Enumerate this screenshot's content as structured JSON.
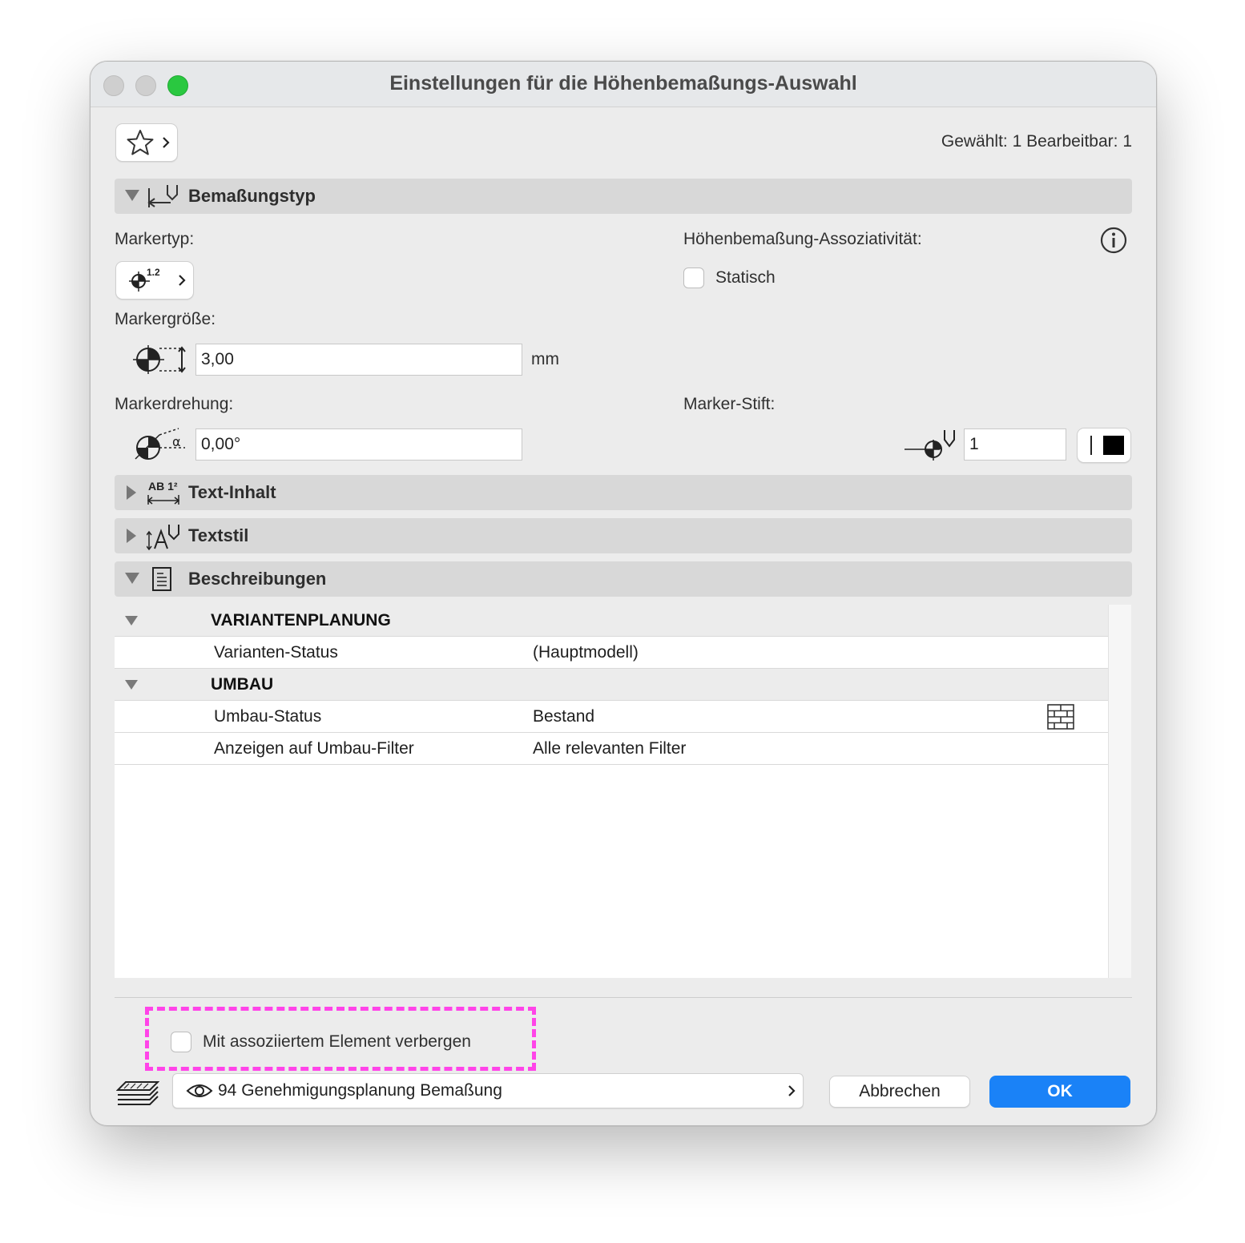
{
  "window": {
    "title": "Einstellungen für die Höhenbemaßungs-Auswahl"
  },
  "header": {
    "selection_info": "Gewählt: 1 Bearbeitbar: 1"
  },
  "sections": {
    "dimension_type": "Bemaßungstyp",
    "text_content": "Text-Inhalt",
    "text_style": "Textstil",
    "descriptions": "Beschreibungen"
  },
  "dimension_type": {
    "marker_type_label": "Markertyp:",
    "marker_icon_label": "1.2",
    "associativity_label": "Höhenbemaßung-Assoziativität:",
    "static_label": "Statisch",
    "marker_size_label": "Markergröße:",
    "marker_size_value": "3,00",
    "marker_size_unit": "mm",
    "marker_rotation_label": "Markerdrehung:",
    "marker_rotation_value": "0,00°",
    "marker_pen_label": "Marker-Stift:",
    "marker_pen_value": "1",
    "text_content_icon": "AB 1²"
  },
  "descriptions": {
    "groups": [
      {
        "name": "VARIANTENPLANUNG",
        "rows": [
          {
            "key": "Varianten-Status",
            "value": "(Hauptmodell)"
          }
        ]
      },
      {
        "name": "UMBAU",
        "rows": [
          {
            "key": "Umbau-Status",
            "value": "Bestand"
          },
          {
            "key": "Anzeigen auf Umbau-Filter",
            "value": "Alle relevanten Filter"
          }
        ]
      }
    ]
  },
  "footer": {
    "hide_with_element_label": "Mit assoziiertem Element verbergen",
    "layer_value": "94 Genehmigungsplanung Bemaßung",
    "cancel_label": "Abbrechen",
    "ok_label": "OK"
  },
  "colors": {
    "accent": "#1a82f7",
    "highlight": "#ff44e8",
    "close": "#cfcfcf",
    "zoom": "#2ac840"
  }
}
